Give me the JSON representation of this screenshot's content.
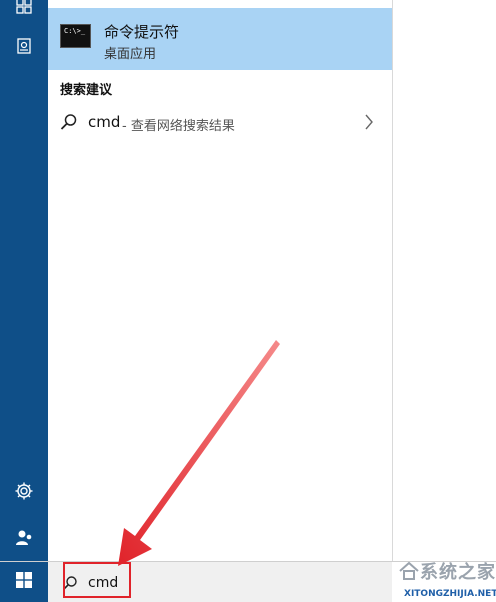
{
  "best_match": {
    "title": "命令提示符",
    "subtitle": "桌面应用",
    "thumb_text": "C:\\>_"
  },
  "suggestions": {
    "header": "搜索建议",
    "items": [
      {
        "main": "cmd",
        "desc": "- 查看网络搜索结果"
      }
    ]
  },
  "search": {
    "value": "cmd"
  },
  "watermark": {
    "text": "系统之家",
    "sub": "XITONGZHIJIA.NET"
  },
  "icons": {
    "rail": [
      "tiles-icon",
      "documents-icon",
      "settings-gear-icon",
      "person-icon"
    ],
    "taskbar": [
      "windows-logo-icon",
      "search-icon"
    ]
  },
  "colors": {
    "rail": "#0f4f88",
    "best_match_bg": "#a9d3f4",
    "annotation": "#e0232a"
  }
}
